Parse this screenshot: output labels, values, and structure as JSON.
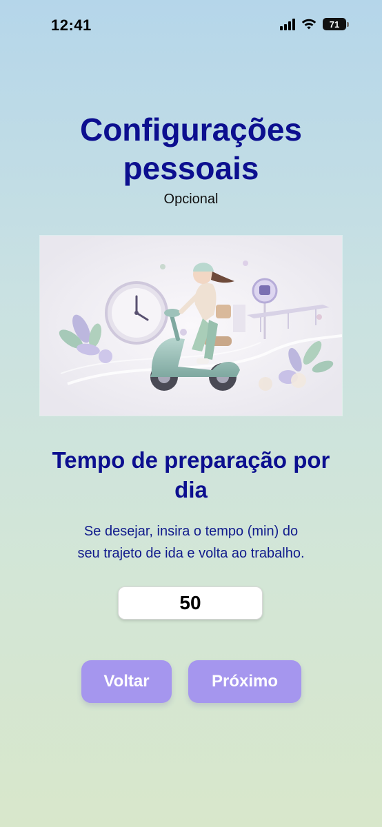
{
  "status_bar": {
    "time": "12:41",
    "battery": "71",
    "icons": [
      "signal-icon",
      "wifi-icon",
      "battery-icon"
    ]
  },
  "header": {
    "title_line1": "Configurações",
    "title_line2": "pessoais",
    "subtitle": "Opcional"
  },
  "illustration": {
    "name": "woman-on-scooter-illustration"
  },
  "section": {
    "title_line1": "Tempo de preparação por",
    "title_line2": "dia",
    "description_line1": "Se desejar, insira o tempo (min) do",
    "description_line2": "seu trajeto de ida e volta ao trabalho."
  },
  "time_input": {
    "value": "50"
  },
  "buttons": {
    "back": "Voltar",
    "next": "Próximo"
  },
  "colors": {
    "title": "#0c0f8f",
    "button": "#a596ee"
  }
}
